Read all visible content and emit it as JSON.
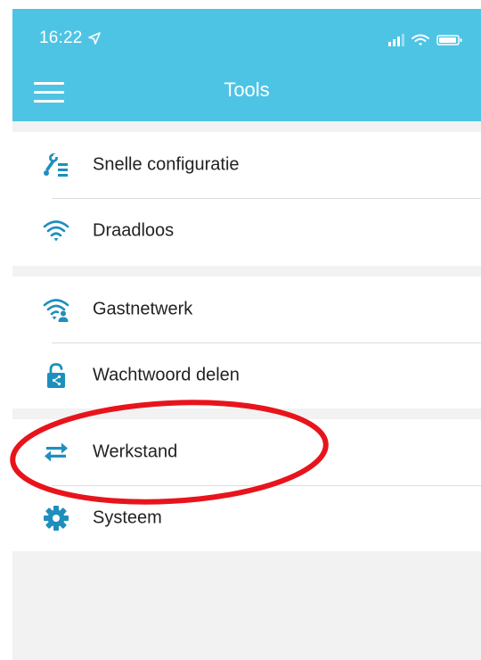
{
  "status_bar": {
    "time": "16:22"
  },
  "header": {
    "title": "Tools"
  },
  "groups": [
    {
      "items": [
        {
          "label": "Snelle configuratie"
        },
        {
          "label": "Draadloos"
        }
      ]
    },
    {
      "items": [
        {
          "label": "Gastnetwerk"
        },
        {
          "label": "Wachtwoord delen"
        }
      ]
    },
    {
      "items": [
        {
          "label": "Werkstand"
        },
        {
          "label": "Systeem"
        }
      ]
    }
  ],
  "colors": {
    "header_bg": "#4ec4e4",
    "icon_accent": "#1e8fbd",
    "content_bg": "#f2f2f2",
    "annotation": "#e8141c"
  }
}
